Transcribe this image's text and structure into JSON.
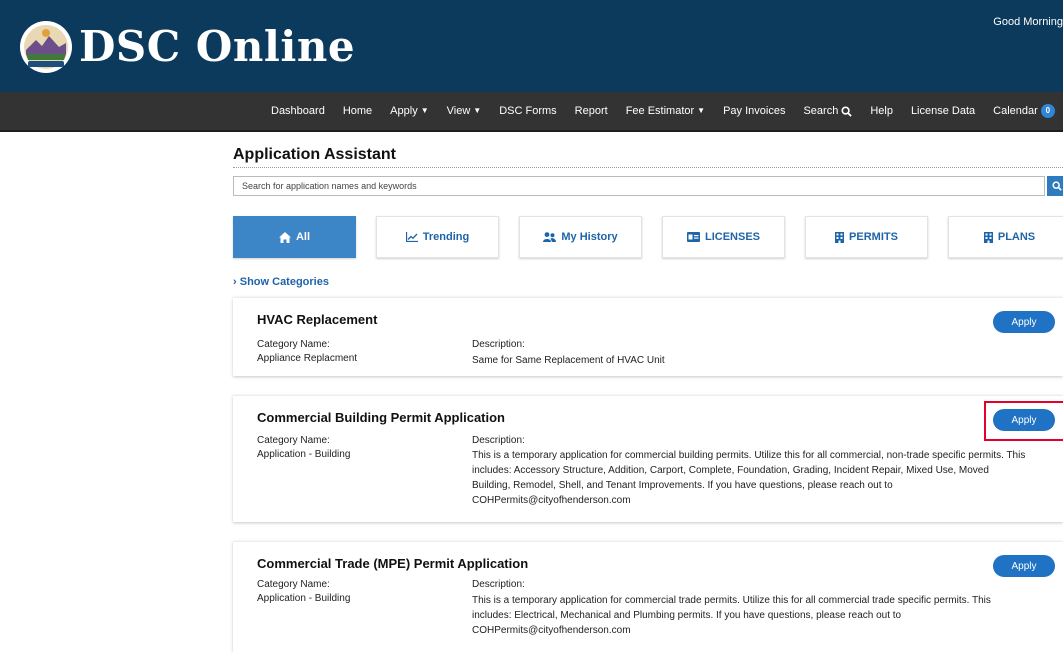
{
  "header": {
    "site_title": "DSC Online",
    "greeting": "Good Morning"
  },
  "nav": {
    "items": [
      {
        "label": "Dashboard"
      },
      {
        "label": "Home"
      },
      {
        "label": "Apply",
        "dropdown": true
      },
      {
        "label": "View",
        "dropdown": true
      },
      {
        "label": "DSC Forms"
      },
      {
        "label": "Report"
      },
      {
        "label": "Fee Estimator",
        "dropdown": true
      },
      {
        "label": "Pay Invoices"
      },
      {
        "label": "Search",
        "icon": "search-icon"
      },
      {
        "label": "Help"
      },
      {
        "label": "License Data"
      },
      {
        "label": "Calendar",
        "badge": "0"
      }
    ]
  },
  "page": {
    "title": "Application Assistant",
    "search_placeholder": "Search for application names and keywords",
    "show_categories": "Show Categories"
  },
  "tabs": [
    {
      "label": "All",
      "icon": "home-icon",
      "active": true
    },
    {
      "label": "Trending",
      "icon": "trend-chart-icon"
    },
    {
      "label": "My History",
      "icon": "users-icon"
    },
    {
      "label": "LICENSES",
      "icon": "id-card-icon"
    },
    {
      "label": "PERMITS",
      "icon": "building-icon"
    },
    {
      "label": "PLANS",
      "icon": "building-icon"
    }
  ],
  "cards": [
    {
      "title": "HVAC Replacement",
      "category_label": "Category Name:",
      "category": "Appliance Replacment",
      "description_label": "Description:",
      "description": "Same for Same Replacement of HVAC Unit",
      "apply_label": "Apply"
    },
    {
      "title": "Commercial Building Permit Application",
      "category_label": "Category Name:",
      "category": "Application - Building",
      "description_label": "Description:",
      "description": "This is a temporary application for commercial building permits. Utilize this for all commercial, non-trade specific permits. This includes: Accessory Structure, Addition, Carport, Complete, Foundation, Grading, Incident Repair, Mixed Use, Moved Building, Remodel, Shell, and Tenant Improvements. If you have questions, please reach out to COHPermits@cityofhenderson.com",
      "apply_label": "Apply",
      "highlight_color": "#e4002b"
    },
    {
      "title": "Commercial Trade (MPE) Permit Application",
      "category_label": "Category Name:",
      "category": "Application - Building",
      "description_label": "Description:",
      "description": "This is a temporary application for commercial trade permits. Utilize this for all commercial trade specific permits. This includes: Electrical, Mechanical and Plumbing permits. If you have questions, please reach out to COHPermits@cityofhenderson.com",
      "apply_label": "Apply"
    }
  ],
  "colors": {
    "header_bg": "#0b3a5c",
    "navbar_bg": "#333333",
    "accent": "#1f72c4",
    "tab_active": "#3c85c7"
  }
}
